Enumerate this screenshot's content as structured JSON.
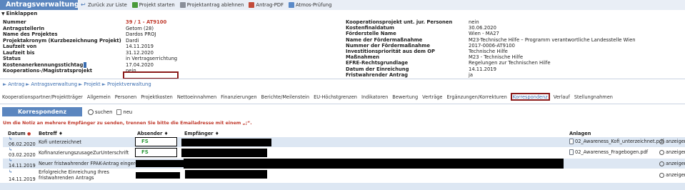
{
  "header": {
    "title": "Antragsverwaltung",
    "toolbar": [
      {
        "label": "Zurück zur Liste",
        "icon": "back-arrow-icon"
      },
      {
        "label": "Projekt starten",
        "icon": "project-start-icon"
      },
      {
        "label": "Projektantrag ablehnen",
        "icon": "print-icon"
      },
      {
        "label": "Antrag-PDF",
        "icon": "pdf-icon"
      },
      {
        "label": "Atmos-Prüfung",
        "icon": "check-icon"
      }
    ]
  },
  "collapse": {
    "label": "Einklappen"
  },
  "info_left": [
    {
      "key": "Nummer",
      "value": "39 / 1 - AT9100",
      "highlight": true
    },
    {
      "key": "AntragstellerIn",
      "value": "Getom (28)"
    },
    {
      "key": "Name des Projektes",
      "value": "Dardos PROJ"
    },
    {
      "key": "Projektakronym (Kurzbezeichnung Projekt)",
      "value": "Dardi"
    },
    {
      "key": "Laufzeit von",
      "value": "14.11.2019"
    },
    {
      "key": "Laufzeit bis",
      "value": "31.12.2020"
    },
    {
      "key": "Status",
      "value": "in Vertragserrichtung"
    },
    {
      "key": "Kostenanerkennungsstichtag",
      "value": "17.04.2020"
    },
    {
      "key": "Kooperations-/Magistratsprojekt",
      "value": "nein"
    }
  ],
  "info_right": [
    {
      "key": "Kooperationsprojekt unt. jur. Personen",
      "value": "nein"
    },
    {
      "key": "Kostenfinaldatum",
      "value": "30.06.2020"
    },
    {
      "key": "Förderstelle Name",
      "value": "Wien - MA27"
    },
    {
      "key": "Name der Fördermaßnahme",
      "value": "M23-Technische Hilfe – Programm verantwortliche Landesstelle Wien"
    },
    {
      "key": "Nummer der Fördermaßnahme",
      "value": "2017-0006-AT9100"
    },
    {
      "key": "Investitionspriorität aus dem OP",
      "value": "Technische Hilfe"
    },
    {
      "key": "Maßnahmen",
      "value": "M23 - Technische Hilfe"
    },
    {
      "key": "EFRE-Rechtsgrundlage",
      "value": "Regelungen zur Technischen Hilfe"
    },
    {
      "key": "Datum der Einreichung",
      "value": "14.11.2019"
    },
    {
      "key": "Fristwahrender Antrag",
      "value": "ja"
    }
  ],
  "breadcrumb": [
    "Antrag",
    "Antragsverwaltung",
    "Projekt",
    "Projektverwaltung"
  ],
  "tabs": [
    "Kooperationspartner/Projektträger",
    "Allgemein",
    "Personen",
    "Projektkosten",
    "Nettoeinnahmen",
    "Finanzierungen",
    "Berichte/Meilenstein",
    "EU-Höchstgrenzen",
    "Indikatoren",
    "Bewertung",
    "Verträge",
    "Ergänzungen/Korrekturen",
    "Korrespondenz",
    "Verlauf",
    "Stellungnahmen"
  ],
  "active_tab": "Korrespondenz",
  "korrespondenz": {
    "title": "Korrespondenz",
    "search_label": "suchen",
    "new_label": "neu",
    "hint": "Um die Notiz an mehrere Empfänger zu senden, trennen Sie bitte die Emailadresse mit einem „;“.",
    "columns": {
      "datum": "Datum",
      "betreff": "Betreff",
      "absender": "Absender",
      "empfaenger": "Empfänger",
      "anlagen": "Anlagen"
    },
    "rows": [
      {
        "date": "06.02.2020",
        "subject": "Kofi unterzeichnet",
        "sender_visible": "FS",
        "attachment": "02_Awareness_Kofi_unterzeichnet.pdf",
        "view_label": "anzeigen"
      },
      {
        "date": "03.02.2020",
        "subject": "KofinanzierungszusageZurUnterschrift",
        "sender_visible": "FS",
        "attachment": "02_Awareness_Fragebogen.pdf",
        "view_label": "anzeigen"
      },
      {
        "date": "14.11.2019",
        "subject": "Neuer fristwahrender FPAK-Antrag eingereicht",
        "sender_visible": "",
        "attachment": "",
        "view_label": "anzeigen"
      },
      {
        "date": "14.11.2019",
        "subject": "Erfolgreiche Einreichung Ihres fristwahrenden Antrags",
        "sender_visible": "",
        "attachment": "",
        "view_label": "anzeigen"
      }
    ]
  },
  "colors": {
    "accent": "#5b86bf",
    "highlight_border": "#8b1a1a",
    "row_alt": "#dde7f3",
    "warning": "#c0392b"
  }
}
